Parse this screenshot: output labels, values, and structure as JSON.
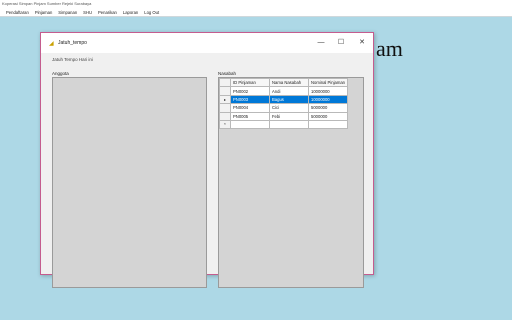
{
  "app": {
    "title": "Koperasi Simpan Pinjam Sumber Rejeki Surabaya"
  },
  "menu": [
    {
      "label": "Pendaftaran"
    },
    {
      "label": "Pinjaman"
    },
    {
      "label": "Simpanan"
    },
    {
      "label": "SHU"
    },
    {
      "label": "Penarikan"
    },
    {
      "label": "Laporan"
    },
    {
      "label": "Log Out"
    }
  ],
  "background_text": "am",
  "dialog": {
    "title": "Jatuh_tempo",
    "subtitle": "Jatuh Tempo Hari ini",
    "minimize_glyph": "—",
    "maximize_glyph": "☐",
    "close_glyph": "✕",
    "left_panel_label": "Anggota",
    "right_panel_label": "Nasabah"
  },
  "grid": {
    "columns": [
      "ID Pinjaman",
      "Nama Nasabah",
      "Nominal Pinjaman"
    ],
    "rows": [
      {
        "marker": "",
        "id": "PN0002",
        "nama": "Andi",
        "nominal": "10000000",
        "selected": false
      },
      {
        "marker": "▸",
        "id": "PN0003",
        "nama": "Bagus",
        "nominal": "10000000",
        "selected": true
      },
      {
        "marker": "",
        "id": "PN0004",
        "nama": "Cici",
        "nominal": "5000000",
        "selected": false
      },
      {
        "marker": "",
        "id": "PN0005",
        "nama": "Febi",
        "nominal": "5000000",
        "selected": false
      }
    ],
    "new_row_marker": "*"
  },
  "colors": {
    "desktop_bg": "#add8e6",
    "selection": "#0078d7",
    "dialog_border": "#c45c8e"
  }
}
